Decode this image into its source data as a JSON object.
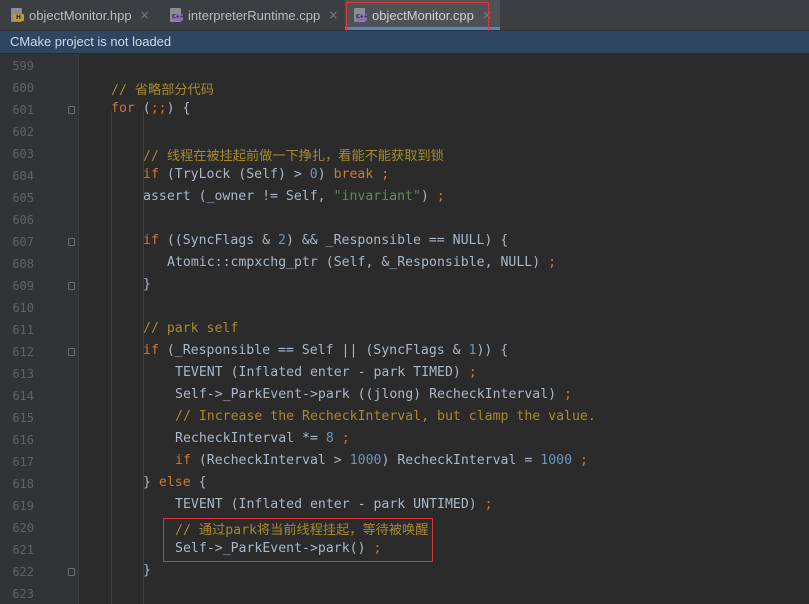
{
  "tabs": [
    {
      "label": "objectMonitor.hpp",
      "icon": "header-file-icon",
      "badge": "H",
      "active": false
    },
    {
      "label": "interpreterRuntime.cpp",
      "icon": "cpp-file-icon",
      "badge": "C++",
      "active": false
    },
    {
      "label": "objectMonitor.cpp",
      "icon": "cpp-file-icon",
      "badge": "C++",
      "active": true
    }
  ],
  "close_glyph": "×",
  "notice": "CMake project is not loaded",
  "line_numbers": [
    "599",
    "600",
    "601",
    "602",
    "603",
    "604",
    "605",
    "606",
    "607",
    "608",
    "609",
    "610",
    "611",
    "612",
    "613",
    "614",
    "615",
    "616",
    "617",
    "618",
    "619",
    "620",
    "621",
    "622",
    "623"
  ],
  "code_lines": [
    [],
    [
      {
        "t": "// 省略部分代码",
        "c": "cm"
      }
    ],
    [
      {
        "t": "for ",
        "c": "kw"
      },
      {
        "t": "(",
        "c": ""
      },
      {
        "t": ";;",
        "c": "kw"
      },
      {
        "t": ") {",
        "c": ""
      }
    ],
    [],
    [
      {
        "t": "// 线程在被挂起前做一下挣扎，看能不能获取到锁",
        "c": "cm"
      }
    ],
    [
      {
        "t": "if ",
        "c": "kw"
      },
      {
        "t": "(TryLock (Self) > ",
        "c": ""
      },
      {
        "t": "0",
        "c": "num"
      },
      {
        "t": ") ",
        "c": ""
      },
      {
        "t": "break ;",
        "c": "kw"
      }
    ],
    [
      {
        "t": "assert (_owner != Self, ",
        "c": ""
      },
      {
        "t": "\"invariant\"",
        "c": "str"
      },
      {
        "t": ") ",
        "c": ""
      },
      {
        "t": ";",
        "c": "kw"
      }
    ],
    [],
    [
      {
        "t": "if ",
        "c": "kw"
      },
      {
        "t": "((SyncFlags & ",
        "c": ""
      },
      {
        "t": "2",
        "c": "num"
      },
      {
        "t": ") && _Responsible == NULL) {",
        "c": ""
      }
    ],
    [
      {
        "t": "Atomic::cmpxchg_ptr (Self, &_Responsible, NULL) ",
        "c": ""
      },
      {
        "t": ";",
        "c": "kw"
      }
    ],
    [
      {
        "t": "}",
        "c": ""
      }
    ],
    [],
    [
      {
        "t": "// park self",
        "c": "cm"
      }
    ],
    [
      {
        "t": "if ",
        "c": "kw"
      },
      {
        "t": "(_Responsible == Self || (SyncFlags & ",
        "c": ""
      },
      {
        "t": "1",
        "c": "num"
      },
      {
        "t": ")) {",
        "c": ""
      }
    ],
    [
      {
        "t": "TEVENT (Inflated enter - park TIMED) ",
        "c": ""
      },
      {
        "t": ";",
        "c": "kw"
      }
    ],
    [
      {
        "t": "Self->_ParkEvent->park ((jlong) RecheckInterval) ",
        "c": ""
      },
      {
        "t": ";",
        "c": "kw"
      }
    ],
    [
      {
        "t": "// Increase the RecheckInterval, but clamp the value.",
        "c": "cm"
      }
    ],
    [
      {
        "t": "RecheckInterval *= ",
        "c": ""
      },
      {
        "t": "8",
        "c": "num"
      },
      {
        "t": " ;",
        "c": "kw"
      }
    ],
    [
      {
        "t": "if ",
        "c": "kw"
      },
      {
        "t": "(RecheckInterval > ",
        "c": ""
      },
      {
        "t": "1000",
        "c": "num"
      },
      {
        "t": ") RecheckInterval = ",
        "c": ""
      },
      {
        "t": "1000",
        "c": "num"
      },
      {
        "t": " ;",
        "c": "kw"
      }
    ],
    [
      {
        "t": "} ",
        "c": ""
      },
      {
        "t": "else ",
        "c": "kw"
      },
      {
        "t": "{",
        "c": ""
      }
    ],
    [
      {
        "t": "TEVENT (Inflated enter - park UNTIMED) ",
        "c": ""
      },
      {
        "t": ";",
        "c": "kw"
      }
    ],
    [
      {
        "t": "// 通过park将当前线程挂起，等待被唤醒",
        "c": "cm"
      }
    ],
    [
      {
        "t": "Self->_ParkEvent->park() ",
        "c": ""
      },
      {
        "t": ";",
        "c": "kw"
      }
    ],
    [
      {
        "t": "}",
        "c": ""
      }
    ],
    []
  ],
  "colors": {
    "keyword": "#cc7832",
    "number": "#6897bb",
    "string": "#6a8759",
    "comment": "#a68a2c",
    "highlight_box": "#d93838"
  }
}
